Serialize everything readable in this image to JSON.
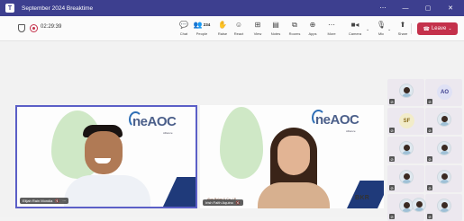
{
  "window": {
    "title": "September 2024 Breaktime",
    "controls": [
      "⋯",
      "—",
      "▢",
      "✕"
    ]
  },
  "meeting": {
    "timer": "02:29:39"
  },
  "toolbar": {
    "chat_label": "Chat",
    "people_label": "People",
    "people_count": "234",
    "raise_label": "Raise",
    "react_label": "React",
    "view_label": "View",
    "notes_label": "Notes",
    "rooms_label": "Rooms",
    "apps_label": "Apps",
    "more_label": "More",
    "camera_label": "Camera",
    "mic_label": "Mic",
    "share_label": "Share",
    "leave_label": "Leave"
  },
  "videos": [
    {
      "name": "Elijah Rain Mondia",
      "logo_text": "neAOC",
      "tagline": "Alliance"
    },
    {
      "name": "Irish Faith Aquino",
      "brand_tag": "Alon Bolan & Co. / P",
      "logo_text": "neAOC",
      "tagline": "Alliance",
      "watermark": "BKR"
    }
  ],
  "gallery": [
    {
      "type": "avatar"
    },
    {
      "type": "initials",
      "text": "AO",
      "color": "#3d3f8f",
      "bg": "#dfe1f5"
    },
    {
      "type": "initials",
      "text": "SF",
      "color": "#8a6d1f",
      "bg": "#f2ecc9"
    },
    {
      "type": "avatar"
    },
    {
      "type": "avatar"
    },
    {
      "type": "avatar"
    },
    {
      "type": "avatar"
    },
    {
      "type": "avatar"
    },
    {
      "type": "avatar"
    },
    {
      "type": "avatar"
    },
    {
      "type": "avatar"
    }
  ],
  "colors": {
    "titlebar": "#3d3f8f",
    "leave": "#c4314b",
    "active_border": "#5b5fc7"
  }
}
